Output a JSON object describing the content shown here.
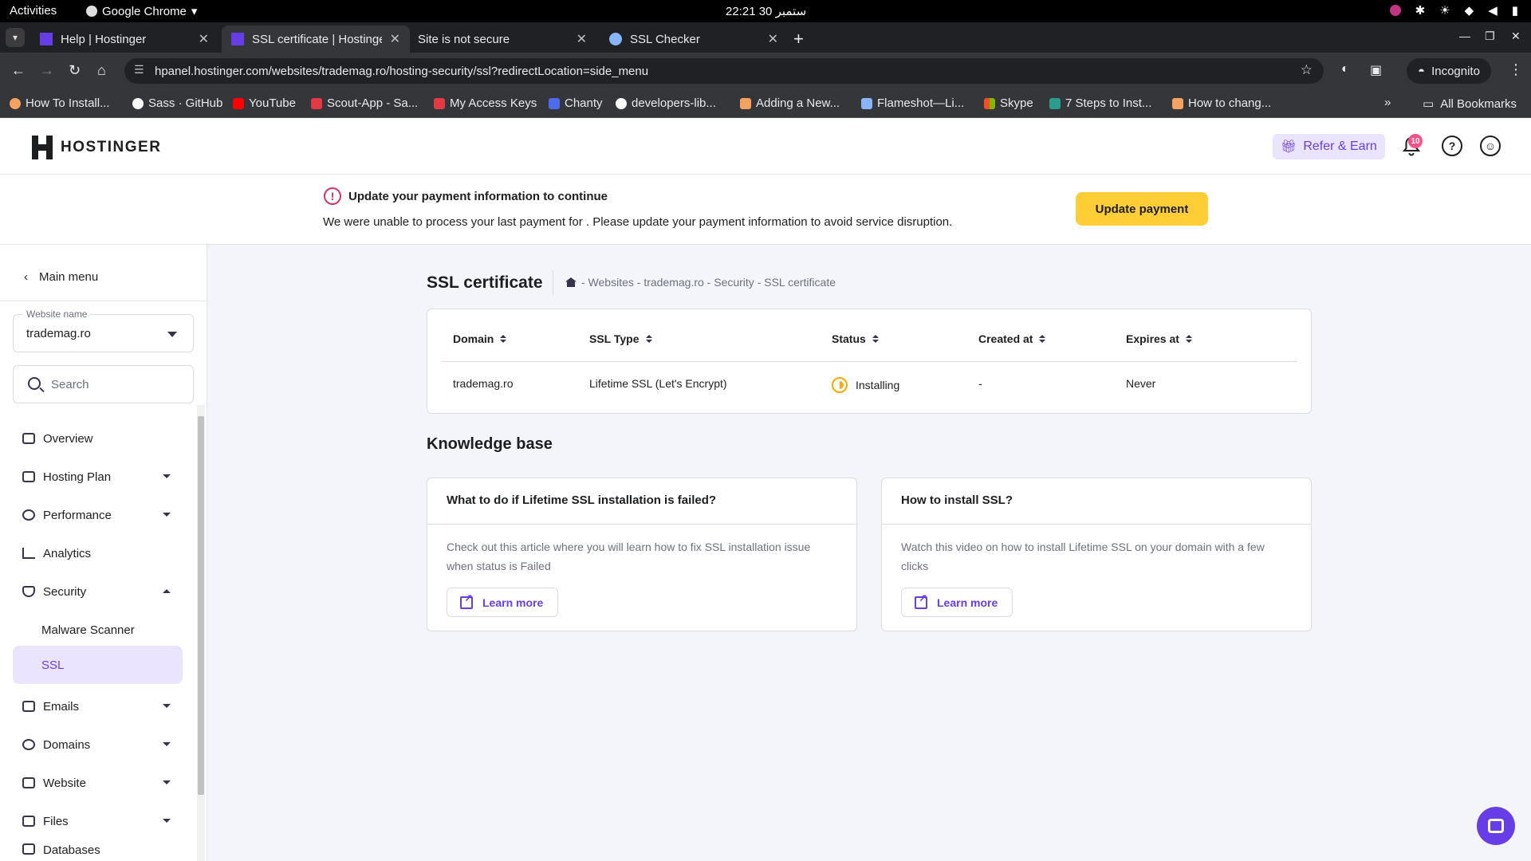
{
  "os": {
    "activities": "Activities",
    "app_name": "Google Chrome",
    "clock": "22:21 30 ستمبر"
  },
  "browser": {
    "tabs": [
      {
        "title": "Help | Hostinger",
        "favicon_color": "#673de6"
      },
      {
        "title": "SSL certificate | Hostinger",
        "favicon_color": "#673de6"
      },
      {
        "title": "Site is not secure",
        "favicon_color": ""
      },
      {
        "title": "SSL Checker",
        "favicon_color": "#8ab4f8"
      }
    ],
    "url": "hpanel.hostinger.com/websites/trademag.ro/hosting-security/ssl?redirectLocation=side_menu",
    "incognito_label": "Incognito",
    "bookmarks": [
      {
        "label": "How To Install...",
        "color": "#f4a261"
      },
      {
        "label": "Sass · GitHub",
        "color": "#ffffff"
      },
      {
        "label": "YouTube",
        "color": "#ff0000"
      },
      {
        "label": "Scout-App - Sa...",
        "color": "#e63946"
      },
      {
        "label": "My Access Keys",
        "color": "#e63946"
      },
      {
        "label": "Chanty",
        "color": "#4f6bed"
      },
      {
        "label": "developers-lib...",
        "color": "#ffffff"
      },
      {
        "label": "Adding a New...",
        "color": "#f4a261"
      },
      {
        "label": "Flameshot—Li...",
        "color": "#8ab4f8"
      },
      {
        "label": "Skype",
        "color": "#2a9d8f"
      },
      {
        "label": "7 Steps to Inst...",
        "color": "#2a9d8f"
      },
      {
        "label": "How to chang...",
        "color": "#f4a261"
      }
    ],
    "all_bookmarks": "All Bookmarks"
  },
  "header": {
    "brand": "HOSTINGER",
    "refer_label": "Refer & Earn",
    "notification_count": "10",
    "accent_color": "#673de6"
  },
  "banner": {
    "title": "Update your payment information to continue",
    "text": "We were unable to process your last payment for . Please update your payment information to avoid service disruption.",
    "button": "Update payment"
  },
  "sidebar": {
    "main_menu": "Main menu",
    "website_label": "Website name",
    "website_value": "trademag.ro",
    "search_placeholder": "Search",
    "items": [
      {
        "label": "Overview",
        "caret": ""
      },
      {
        "label": "Hosting Plan",
        "caret": "down"
      },
      {
        "label": "Performance",
        "caret": "down"
      },
      {
        "label": "Analytics",
        "caret": ""
      },
      {
        "label": "Security",
        "caret": "up"
      },
      {
        "label": "Malware Scanner",
        "caret": "",
        "sub": true
      },
      {
        "label": "SSL",
        "caret": "",
        "sub": true,
        "active": true
      },
      {
        "label": "Emails",
        "caret": "down"
      },
      {
        "label": "Domains",
        "caret": "down"
      },
      {
        "label": "Website",
        "caret": "down"
      },
      {
        "label": "Files",
        "caret": "down"
      },
      {
        "label": "Databases",
        "caret": "down"
      }
    ]
  },
  "page": {
    "title": "SSL certificate",
    "breadcrumb": "- Websites - trademag.ro - Security - SSL certificate",
    "table": {
      "headers": [
        "Domain",
        "SSL Type",
        "Status",
        "Created at",
        "Expires at"
      ],
      "row": [
        "trademag.ro",
        "Lifetime SSL (Let's Encrypt)",
        "Installing",
        "-",
        "Never"
      ]
    },
    "kb_title": "Knowledge base",
    "kb_cards": [
      {
        "title": "What to do if Lifetime SSL installation is failed?",
        "text": "Check out this article where you will learn how to fix SSL installation issue when status is Failed",
        "button": "Learn more"
      },
      {
        "title": "How to install SSL?",
        "text": "Watch this video on how to install Lifetime SSL on your domain with a few clicks",
        "button": "Learn more"
      }
    ]
  }
}
